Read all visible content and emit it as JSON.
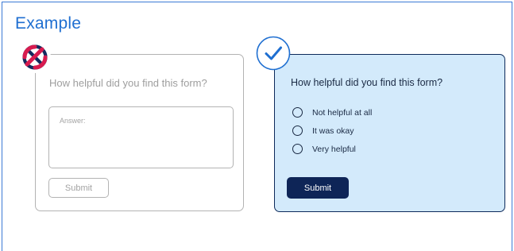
{
  "heading": "Example",
  "bad_example": {
    "question": "How helpful did you find this form?",
    "answer_placeholder": "Answer:",
    "submit_label": "Submit",
    "badge_icon": "prohibited-icon",
    "colors": {
      "badge": "#d81b4f",
      "badge_stroke": "#132a5e"
    }
  },
  "good_example": {
    "question": "How helpful did you find this form?",
    "options": [
      "Not helpful at all",
      "It was okay",
      "Very helpful"
    ],
    "submit_label": "Submit",
    "badge_icon": "checkmark-icon",
    "colors": {
      "card_bg": "#d3eafb",
      "accent": "#1f6fd1",
      "button": "#0e2557"
    }
  }
}
